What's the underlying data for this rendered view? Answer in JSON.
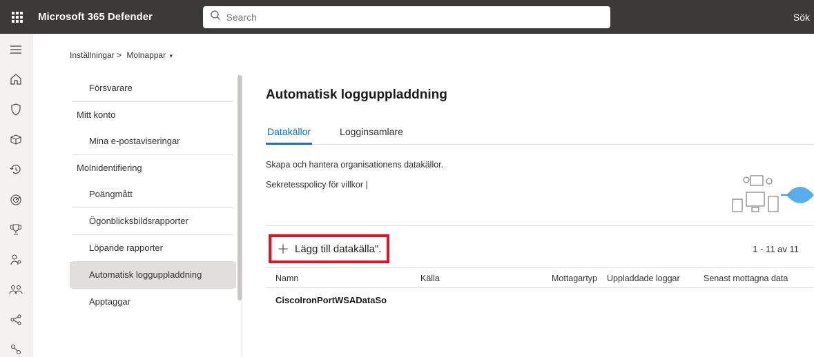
{
  "app_title": "Microsoft 365 Defender",
  "search_placeholder": "Search",
  "top_right": "Sök",
  "breadcrumb": {
    "root": "Inställningar >",
    "current": "Molnappar"
  },
  "settings_nav": {
    "defender": "Försvarare",
    "my_account": "Mitt konto",
    "email_notif": "Mina e-postaviseringar",
    "cloud_discovery": "Molnidentifiering",
    "score_metrics": "Poängmått",
    "snapshot_reports": "Ögonblicksbildsrapporter",
    "continuous_reports": "Löpande rapporter",
    "auto_log_upload": "Automatisk logguppladdning",
    "app_tags": "Apptaggar"
  },
  "main": {
    "heading": "Automatisk logguppladdning",
    "tab_sources": "Datakällor",
    "tab_collectors": "Logginsamlare",
    "desc_line1": "Skapa och hantera organisationens datakällor.",
    "desc_line2": "Sekretesspolicy för villkor |",
    "add_button": "Lägg till datakälla\".",
    "count": "1 - 11 av 11",
    "cols": {
      "name": "Namn",
      "source": "Källa",
      "receiver": "Mottagartyp",
      "uploaded": "Uppladdade loggar",
      "last": "Senast mottagna data"
    },
    "row1": {
      "name": "CiscoIronPortWSADataSo"
    }
  }
}
